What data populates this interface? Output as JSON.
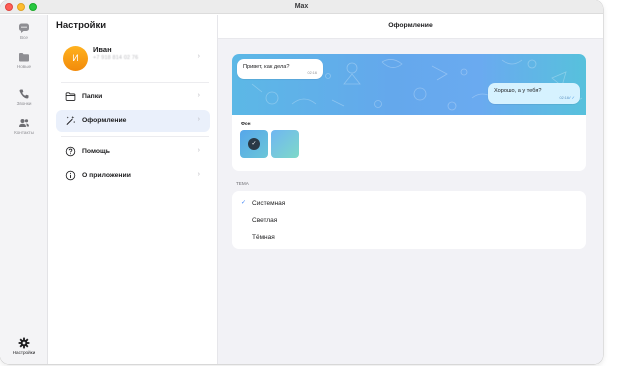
{
  "window": {
    "title": "Max"
  },
  "rail": {
    "items": [
      {
        "label": "Все",
        "icon": "chat-bubble-icon"
      },
      {
        "label": "Новые",
        "icon": "folder-icon"
      },
      {
        "label": "Звонки",
        "icon": "phone-icon"
      },
      {
        "label": "Контакты",
        "icon": "contacts-icon"
      }
    ],
    "settings": {
      "label": "Настройки",
      "icon": "gear-icon"
    }
  },
  "settings": {
    "title": "Настройки",
    "profile": {
      "initial": "И",
      "name": "Иван",
      "phone": "+7 918 814 02 76"
    },
    "menu": [
      {
        "label": "Папки",
        "icon": "folder-outline-icon"
      },
      {
        "label": "Оформление",
        "icon": "magic-wand-icon"
      },
      {
        "label": "Помощь",
        "icon": "help-icon"
      },
      {
        "label": "О приложении",
        "icon": "info-icon"
      }
    ],
    "chevron": "›"
  },
  "main": {
    "title": "Оформление",
    "preview": {
      "incoming_text": "Привет, как дела?",
      "incoming_time": "02:16",
      "outgoing_text": "Хорошо, а у тебя?",
      "outgoing_time": "02:16"
    },
    "background_label": "Фон",
    "theme_label": "ТЕМА",
    "themes": [
      {
        "label": "Системная",
        "selected": true
      },
      {
        "label": "Светлая",
        "selected": false
      },
      {
        "label": "Тёмная",
        "selected": false
      }
    ],
    "colors": {
      "accent": "#3b82f6",
      "active_bg": "#eaf0fb",
      "avatar": "#f7a114"
    }
  }
}
